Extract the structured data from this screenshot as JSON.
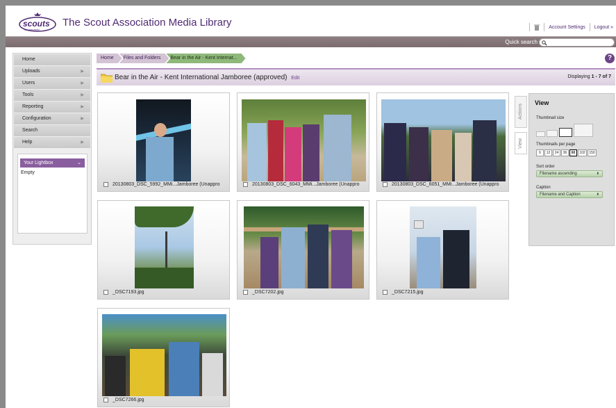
{
  "header": {
    "logo_text": "scouts",
    "logo_tagline": "be prepared",
    "title": "The Scout Association Media Library",
    "account_settings": "Account Settings",
    "logout": "Logout »"
  },
  "search": {
    "label": "Quick search",
    "placeholder": ""
  },
  "sidebar": {
    "items": [
      {
        "label": "Home",
        "arrow": ""
      },
      {
        "label": "Uploads",
        "arrow": "▶"
      },
      {
        "label": "Users",
        "arrow": "▶"
      },
      {
        "label": "Tools",
        "arrow": "▶"
      },
      {
        "label": "Reporting",
        "arrow": "▶"
      },
      {
        "label": "Configuration",
        "arrow": "▶"
      },
      {
        "label": "Search",
        "arrow": ""
      },
      {
        "label": "Help",
        "arrow": "▶"
      }
    ],
    "lightbox": {
      "title": "Your Lightbox",
      "chevron": "⌄",
      "status": "Empty"
    }
  },
  "breadcrumb": [
    "Home",
    "Files and Folders",
    "Bear in the Air - Kent Internat..."
  ],
  "folder": {
    "title": "Bear in the Air - Kent International Jamboree (approved)",
    "edit": "Edit",
    "displaying_prefix": "Displaying ",
    "displaying_range": "1 - 7 of 7"
  },
  "thumbnails": [
    {
      "caption": "20130803_DSC_5992_MMi...Jamboree (Unappro"
    },
    {
      "caption": "20130803_DSC_6043_MMi...Jamboree (Unappro"
    },
    {
      "caption": "20130803_DSC_6051_MMi...Jamboree (Unappro"
    },
    {
      "caption": "_DSC7193.jpg"
    },
    {
      "caption": "_DSC7202.jpg"
    },
    {
      "caption": "_DSC7215.jpg"
    },
    {
      "caption": "_DSC7266.jpg"
    }
  ],
  "side_tabs": {
    "actions": "Actions",
    "view": "View"
  },
  "view_panel": {
    "title": "View",
    "thumb_size_label": "Thumbnail size",
    "per_page_label": "Thumbnails per page",
    "per_page_options": [
      "6",
      "12",
      "24",
      "36",
      "60",
      "102",
      "150"
    ],
    "per_page_selected": "60",
    "sort_label": "Sort order",
    "sort_value": "Filename ascending",
    "caption_label": "Caption",
    "caption_value": "Filename and Caption",
    "select_arrows": "⬍"
  },
  "help_icon": "?",
  "colors": {
    "brand_purple": "#4f2a72",
    "active_crumb": "#8fb87b"
  }
}
